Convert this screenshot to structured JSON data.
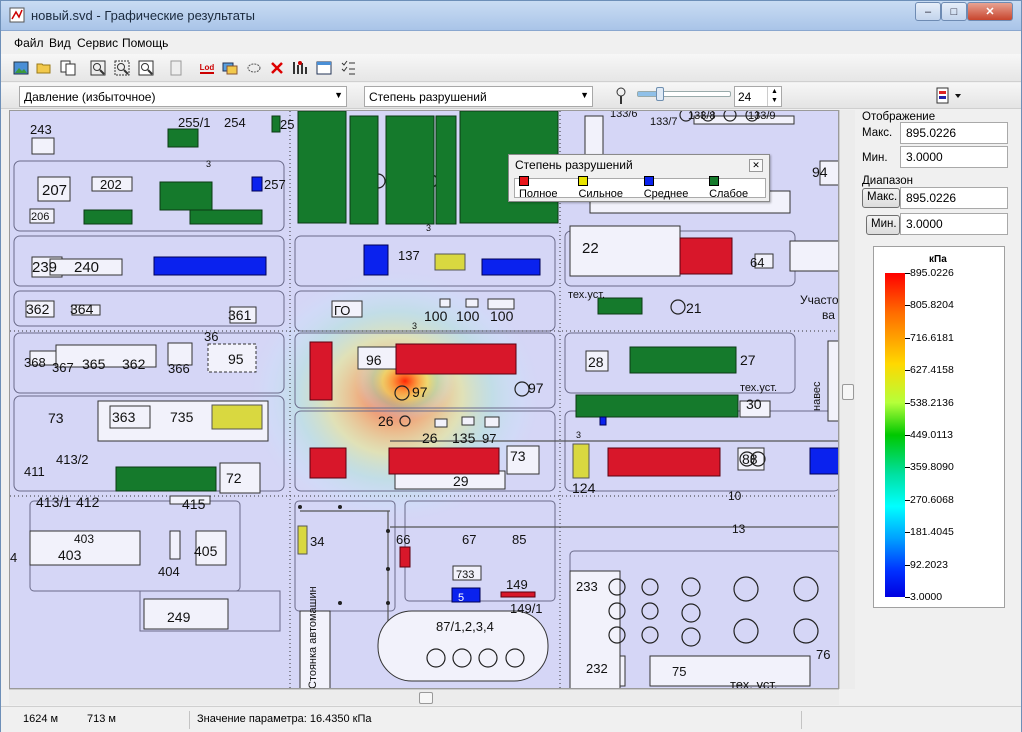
{
  "window": {
    "title": "новый.svd - Графические результаты",
    "controls": {
      "minimize": "–",
      "maximize": "□",
      "close": "✕"
    }
  },
  "menu": [
    "Файл",
    "Вид",
    "Сервис",
    "Помощь"
  ],
  "toolbar": {
    "icons": [
      "image-icon",
      "open-folder-icon",
      "copy-icon",
      "zoom-fit-icon",
      "zoom-window-icon",
      "zoom-icon",
      "document-icon",
      "lod-icon",
      "layers-icon",
      "lasso-icon",
      "delete-icon",
      "grid-icon",
      "table-icon",
      "checklist-icon"
    ],
    "lod_label": "Lod"
  },
  "toolbar2": {
    "parameter": "Давление (избыточное)",
    "damage_mode": "Степень разрушений",
    "slider_fraction": 0.24,
    "slider_value": "24"
  },
  "legend": {
    "title": "Степень разрушений",
    "items": [
      {
        "label": "Полное",
        "color": "#e8151b"
      },
      {
        "label": "Сильное",
        "color": "#e9e400"
      },
      {
        "label": "Среднее",
        "color": "#0a22ee"
      },
      {
        "label": "Слабое",
        "color": "#157a2c"
      }
    ]
  },
  "panel": {
    "display_label": "Отображение",
    "max_label": "Макс.",
    "max_value": "895.0226",
    "min_label": "Мин.",
    "min_value": "3.0000",
    "range_label": "Диапазон",
    "range_max_button": "Макс.",
    "range_max_value": "895.0226",
    "range_min_button": "Мин.",
    "range_min_value": "3.0000"
  },
  "colorbar": {
    "unit": "кПа",
    "ticks": [
      "895.0226",
      "805.8204",
      "716.6181",
      "627.4158",
      "538.2136",
      "449.0113",
      "359.8090",
      "270.6068",
      "181.4045",
      "92.2023",
      "3.0000"
    ]
  },
  "map_labels": [
    "243",
    "255/1",
    "254",
    "25",
    "133/6",
    "133/7",
    "133/8",
    "133/9",
    "207",
    "202",
    "257",
    "94",
    "206",
    "22",
    "64",
    "239",
    "240",
    "137",
    "362",
    "364",
    "361",
    "ГО",
    "100",
    "100",
    "100",
    "тех.уст.",
    "21",
    "Участо",
    "ва",
    "368",
    "367",
    "365",
    "362",
    "366",
    "36",
    "95",
    "96",
    "28",
    "27",
    "97",
    "97",
    "навес",
    "73",
    "363",
    "735",
    "26",
    "26",
    "135",
    "97",
    "тех.уст.",
    "30",
    "413/2",
    "411",
    "72",
    "73",
    "124",
    "88",
    "29",
    "413/1",
    "412",
    "415",
    "403",
    "403",
    "405",
    "404",
    "4",
    "34",
    "66",
    "67",
    "85",
    "733",
    "149",
    "149/1",
    "233",
    "249",
    "87/1,2,3,4",
    "232",
    "75",
    "76",
    "тех. уст.",
    "Стоянка автомашин",
    "3",
    "3",
    "3",
    "3",
    "10",
    "13",
    "5"
  ],
  "status": {
    "coord_x": "1624 м",
    "coord_y": "713 м",
    "value_text": "Значение параметра: 16.4350 кПа"
  }
}
